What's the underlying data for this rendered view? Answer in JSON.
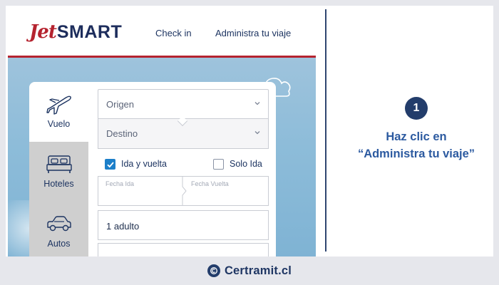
{
  "site": {
    "logo_jet": "Jet",
    "logo_smart": "SMART",
    "nav": {
      "checkin": "Check in",
      "admin": "Administra tu viaje"
    }
  },
  "tabs": [
    {
      "label": "Vuelo",
      "icon": "plane-icon"
    },
    {
      "label": "Hoteles",
      "icon": "bed-icon"
    },
    {
      "label": "Autos",
      "icon": "car-icon"
    }
  ],
  "form": {
    "origen": "Origen",
    "destino": "Destino",
    "ida_y_vuelta": "Ida y vuelta",
    "solo_ida": "Solo Ida",
    "fecha_ida": "Fecha Ida",
    "fecha_vuelta": "Fecha Vuelta",
    "pasajeros": "1 adulto"
  },
  "step": {
    "number": "1",
    "line1": "Haz clic en",
    "line2": "“Administra tu viaje”"
  },
  "footer": {
    "brand": "Certramit.cl"
  },
  "colors": {
    "brand_red": "#b5232f",
    "navy": "#1d3461",
    "accent_blue": "#2c5aa0",
    "check_blue": "#1c7fc9"
  }
}
